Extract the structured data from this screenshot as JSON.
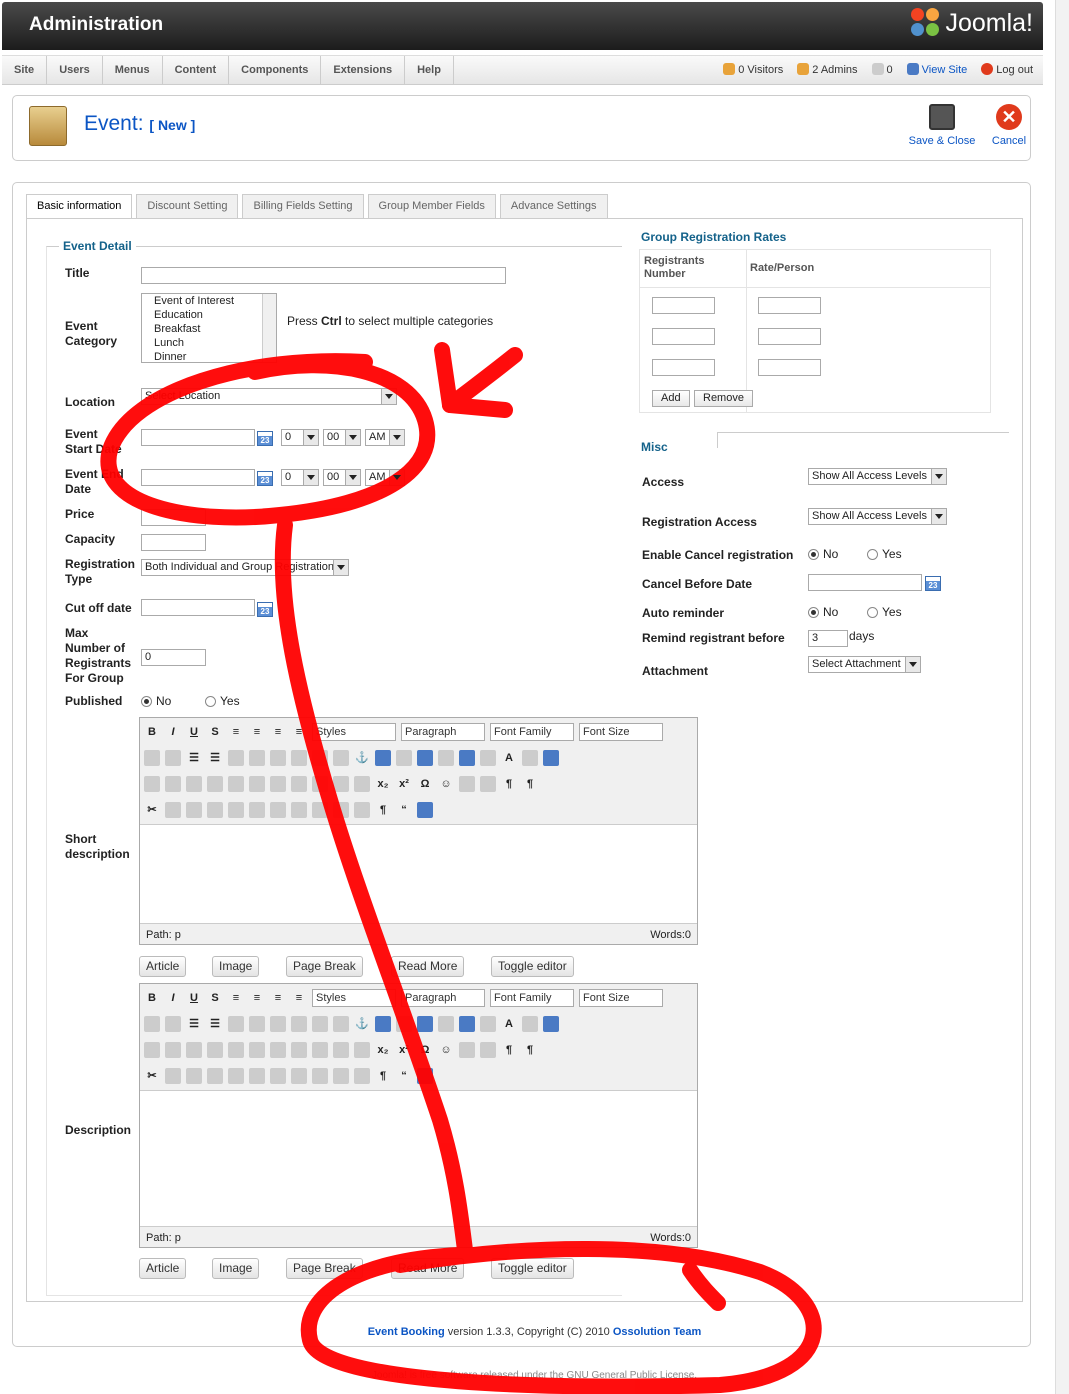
{
  "header": {
    "title": "Administration",
    "logo_text": "Joomla!"
  },
  "menu": {
    "items": [
      "Site",
      "Users",
      "Menus",
      "Content",
      "Components",
      "Extensions",
      "Help"
    ]
  },
  "status": {
    "visitors": "0 Visitors",
    "admins": "2 Admins",
    "messages": "0",
    "view_site": "View Site",
    "logout": "Log out"
  },
  "toolbar": {
    "title": "Event:",
    "subtitle": "[ New ]",
    "save_close": "Save & Close",
    "cancel": "Cancel"
  },
  "tabs": [
    "Basic information",
    "Discount Setting",
    "Billing Fields Setting",
    "Group Member Fields",
    "Advance Settings"
  ],
  "event_detail": {
    "legend": "Event Detail",
    "title_label": "Title",
    "title_value": "",
    "category_label": "Event Category",
    "categories": [
      "Event of Interest",
      "Education",
      "Breakfast",
      "Lunch",
      "Dinner"
    ],
    "category_hint_pre": "Press ",
    "category_hint_bold": "Ctrl",
    "category_hint_post": " to select multiple categories",
    "location_label": "Location",
    "location_value": "Select Location",
    "start_label": "Event Start Date",
    "end_label": "Event End Date",
    "hour": "0",
    "minute": "00",
    "ampm": "AM",
    "price_label": "Price",
    "capacity_label": "Capacity",
    "reg_type_label": "Registration Type",
    "reg_type_value": "Both Individual and Group Registration",
    "cutoff_label": "Cut off date",
    "max_group_label": "Max Number of Registrants For Group",
    "max_group_value": "0",
    "published_label": "Published",
    "no": "No",
    "yes": "Yes",
    "short_desc_label": "Short description",
    "desc_label": "Description",
    "editor": {
      "styles": "Styles",
      "paragraph": "Paragraph",
      "font_family": "Font Family",
      "font_size": "Font Size",
      "path": "Path: p",
      "words": "Words:0"
    },
    "editor_buttons": [
      "Article",
      "Image",
      "Page Break",
      "Read More",
      "Toggle editor"
    ]
  },
  "group_rates": {
    "legend": "Group Registration Rates",
    "col1": "Registrants Number",
    "col2": "Rate/Person",
    "add": "Add",
    "remove": "Remove"
  },
  "misc": {
    "legend": "Misc",
    "access_label": "Access",
    "access_value": "Show All Access Levels",
    "reg_access_label": "Registration Access",
    "reg_access_value": "Show All Access Levels",
    "cancel_reg_label": "Enable Cancel registration",
    "cancel_before_label": "Cancel Before Date",
    "auto_reminder_label": "Auto reminder",
    "remind_label": "Remind registrant before",
    "remind_value": "3",
    "remind_unit": "days",
    "attachment_label": "Attachment",
    "attachment_value": "Select Attachment",
    "no": "No",
    "yes": "Yes"
  },
  "footer": {
    "product": "Event Booking",
    "version": " version 1.3.3, Copyright (C) 2010 ",
    "company": "Ossolution Team",
    "license": "Joomla! is free software released under the GNU General Public License."
  },
  "colors": {
    "accent": "#0b55c4",
    "legend": "#14628a",
    "annotation": "#ff0000"
  }
}
